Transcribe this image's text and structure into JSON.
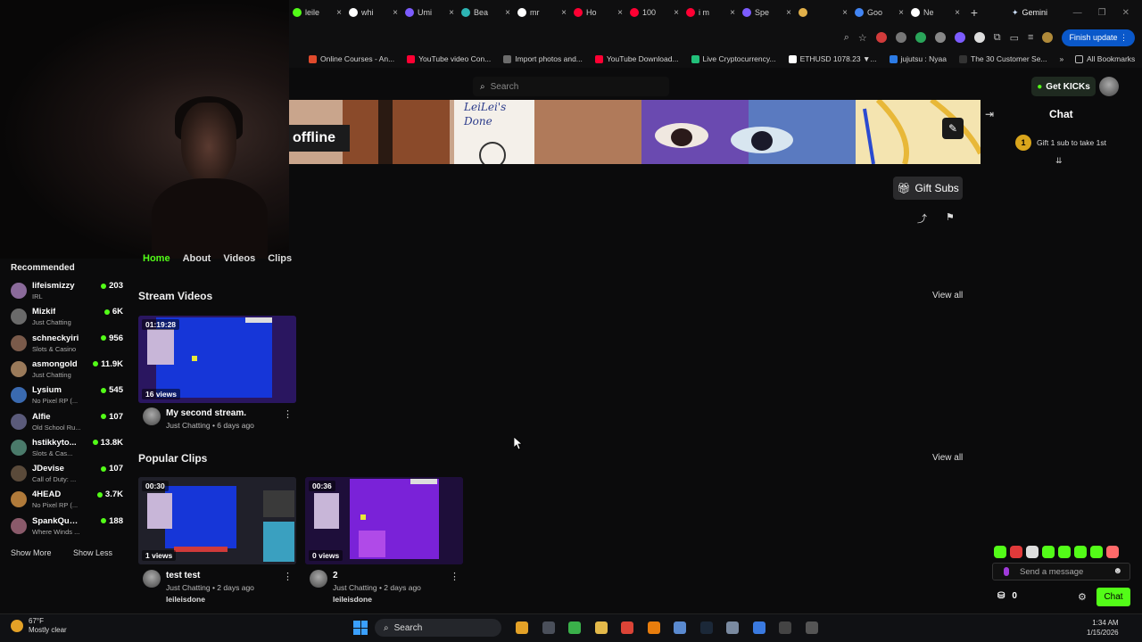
{
  "browser": {
    "tabs": [
      {
        "label": "leile",
        "color": "#53fc18"
      },
      {
        "label": "whi",
        "color": "#ffffff"
      },
      {
        "label": "Umi",
        "color": "#7c5cff"
      },
      {
        "label": "Bea",
        "color": "#2db4b4"
      },
      {
        "label": "mr",
        "color": "#ffffff"
      },
      {
        "label": "Ho",
        "color": "#ff0033"
      },
      {
        "label": "100",
        "color": "#ff0033"
      },
      {
        "label": "i m",
        "color": "#ff0033"
      },
      {
        "label": "Spe",
        "color": "#7c5cff"
      },
      {
        "label": "",
        "color": "#e2b04a"
      },
      {
        "label": "Goo",
        "color": "#4285f4"
      },
      {
        "label": "Ne",
        "color": "#ffffff"
      }
    ],
    "gemini_label": "Gemini",
    "finish_update": "Finish update",
    "bookmarks": [
      {
        "label": "Online Courses - An...",
        "color": "#e04a2c"
      },
      {
        "label": "YouTube video Con...",
        "color": "#ff0033"
      },
      {
        "label": "Import photos and...",
        "color": "#6c6c6c"
      },
      {
        "label": "YouTube Download...",
        "color": "#ff0033"
      },
      {
        "label": "Live Cryptocurrency...",
        "color": "#22c07a"
      },
      {
        "label": "ETHUSD 1078.23 ▼...",
        "color": "#ffffff"
      },
      {
        "label": "jujutsu : Nyaa",
        "color": "#2c7be5"
      },
      {
        "label": "The 30 Customer Se...",
        "color": "#333333"
      }
    ],
    "all_bookmarks": "All Bookmarks"
  },
  "header": {
    "search_placeholder": "Search",
    "get_kicks": "Get KICKs"
  },
  "channel": {
    "status": "offline",
    "banner_text": "LeiLei's Done",
    "gift_subs": "Gift Subs",
    "tabs": [
      "Home",
      "About",
      "Videos",
      "Clips"
    ]
  },
  "sections": {
    "stream_videos": {
      "title": "Stream Videos",
      "view_all": "View all",
      "items": [
        {
          "duration": "01:19:28",
          "views": "16 views",
          "title": "My second stream.",
          "meta": "Just Chatting • 6 days ago"
        }
      ]
    },
    "popular_clips": {
      "title": "Popular Clips",
      "view_all": "View all",
      "items": [
        {
          "duration": "00:30",
          "views": "1 views",
          "title": "test test",
          "meta": "Just Chatting • 2 days ago",
          "user": "leileisdone"
        },
        {
          "duration": "00:36",
          "views": "0 views",
          "title": "2",
          "meta": "Just Chatting • 2 days ago",
          "user": "leileisdone"
        }
      ]
    }
  },
  "sidebar": {
    "title": "Recommended",
    "items": [
      {
        "name": "lifeismizzy",
        "category": "IRL",
        "viewers": "203",
        "color": "#8a6a9a"
      },
      {
        "name": "Mizkif",
        "category": "Just Chatting",
        "viewers": "6K",
        "color": "#6a6a6a"
      },
      {
        "name": "schneckyiri",
        "category": "Slots & Casino",
        "viewers": "956",
        "color": "#7a5a4a"
      },
      {
        "name": "asmongold",
        "category": "Just Chatting",
        "viewers": "11.9K",
        "color": "#9a7a5a"
      },
      {
        "name": "Lysium",
        "category": "No Pixel RP (...",
        "viewers": "545",
        "color": "#3a6ab0"
      },
      {
        "name": "Alfie",
        "category": "Old School Ru...",
        "viewers": "107",
        "color": "#5a5a7a"
      },
      {
        "name": "hstikkyto...",
        "category": "Slots & Cas...",
        "viewers": "13.8K",
        "color": "#4a7a6a"
      },
      {
        "name": "JDevise",
        "category": "Call of Duty: ...",
        "viewers": "107",
        "color": "#5a4a3a"
      },
      {
        "name": "4HEAD",
        "category": "No Pixel RP (...",
        "viewers": "3.7K",
        "color": "#b07a3a"
      },
      {
        "name": "SpankQueen",
        "category": "Where Winds ...",
        "viewers": "188",
        "color": "#8a5a6a"
      }
    ],
    "show_more": "Show More",
    "show_less": "Show Less"
  },
  "chat": {
    "title": "Chat",
    "gift_badge": "1",
    "gift_text": "Gift 1 sub to take 1st",
    "placeholder": "Send a message",
    "kicks_count": "0",
    "send_label": "Chat",
    "emote_colors": [
      "#53fc18",
      "#e03a3a",
      "#dddddd",
      "#53fc18",
      "#53fc18",
      "#53fc18",
      "#53fc18",
      "#ff6a6a"
    ]
  },
  "taskbar": {
    "temp": "67°F",
    "weather": "Mostly clear",
    "search": "Search",
    "time": "1:34 AM",
    "date": "1/15/2026",
    "icons": [
      {
        "name": "burger-icon",
        "color": "#e3a127"
      },
      {
        "name": "window-icon",
        "color": "#4a4f5a"
      },
      {
        "name": "green-app-icon",
        "color": "#3ab04a"
      },
      {
        "name": "folder-icon",
        "color": "#e3b94a"
      },
      {
        "name": "chrome-icon",
        "color": "#db4437"
      },
      {
        "name": "blender-icon",
        "color": "#e87d0d"
      },
      {
        "name": "steam-blue-icon",
        "color": "#5a8ad0"
      },
      {
        "name": "steam-icon",
        "color": "#1b2838"
      },
      {
        "name": "settings-icon",
        "color": "#7a8aa0"
      },
      {
        "name": "blue-app-icon",
        "color": "#3a7ae0"
      },
      {
        "name": "obs-icon",
        "color": "#444444"
      },
      {
        "name": "media-player-icon",
        "color": "#555555"
      }
    ]
  }
}
